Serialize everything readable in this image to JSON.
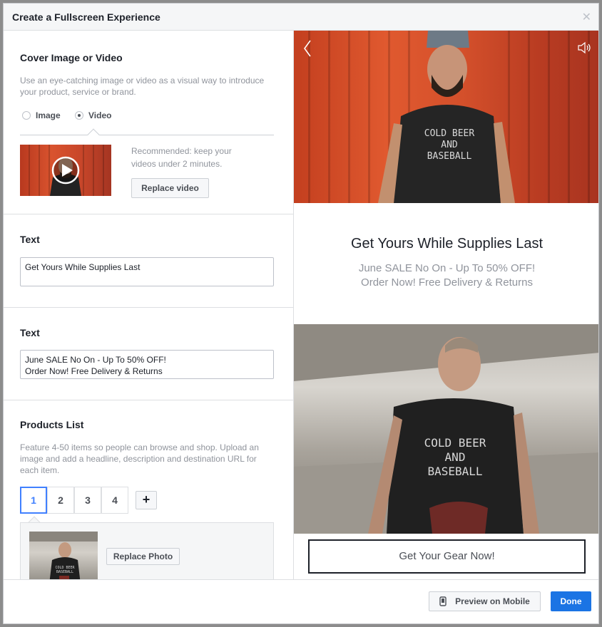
{
  "dialog": {
    "title": "Create a Fullscreen Experience",
    "close_icon": "close-icon"
  },
  "cover": {
    "heading": "Cover Image or Video",
    "description": "Use an eye-catching image or video as a visual way to introduce your product, service or brand.",
    "options": [
      {
        "label": "Image",
        "selected": false
      },
      {
        "label": "Video",
        "selected": true
      }
    ],
    "recommendation": "Recommended: keep your videos under 2 minutes.",
    "replace_label": "Replace video",
    "play_icon": "play-icon"
  },
  "text1": {
    "heading": "Text",
    "value": "Get Yours While Supplies Last"
  },
  "text2": {
    "heading": "Text",
    "value": "June SALE No On - Up To 50% OFF!\nOrder Now! Free Delivery & Returns"
  },
  "products": {
    "heading": "Products List",
    "description": "Feature 4-50 items so people can browse and shop. Upload an image and add a headline, description and destination URL for each item.",
    "tabs": [
      "1",
      "2",
      "3",
      "4"
    ],
    "active_tab": "1",
    "add_label": "+",
    "replace_photo_label": "Replace Photo",
    "shirt_lines": [
      "COLD BEER",
      "AND",
      "BASEBALL"
    ]
  },
  "preview": {
    "headline": "Get Yours While Supplies Last",
    "subtext": "June SALE No On - Up To 50% OFF!\nOrder Now! Free Delivery & Returns",
    "cta": "Get Your Gear Now!",
    "back_icon": "chevron-left-icon",
    "sound_icon": "speaker-icon",
    "shirt_lines": [
      "COLD BEER",
      "AND",
      "BASEBALL"
    ]
  },
  "footer": {
    "preview_label": "Preview on Mobile",
    "done_label": "Done",
    "phone_icon": "phone-icon"
  },
  "colors": {
    "accent": "#1b74e4",
    "tab_active": "#4080ff",
    "hero_red": "#d4502b"
  }
}
